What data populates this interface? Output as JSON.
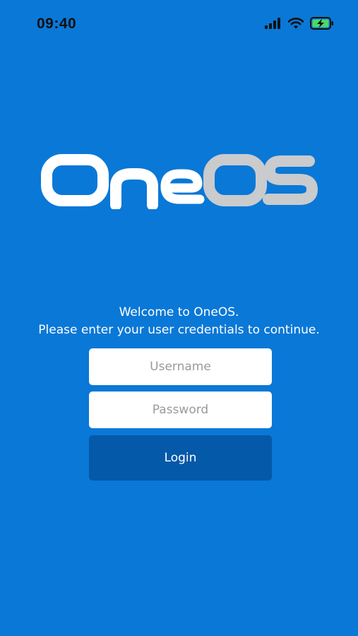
{
  "status_bar": {
    "time": "09:40",
    "signal_icon": "cellular-signal-icon",
    "wifi_icon": "wifi-icon",
    "battery_icon": "battery-charging-icon"
  },
  "logo": {
    "part1": "One",
    "part2": "OS",
    "colors": {
      "part1": "#FFFFFF",
      "part2": "#C9CBCD"
    }
  },
  "welcome": {
    "line1": "Welcome to OneOS.",
    "line2": "Please enter your user credentials to continue."
  },
  "form": {
    "username": {
      "placeholder": "Username",
      "value": ""
    },
    "password": {
      "placeholder": "Password",
      "value": ""
    },
    "login_label": "Login"
  },
  "colors": {
    "background": "#0A78D7",
    "login_button": "#0459A8",
    "battery_fill": "#4CD964"
  }
}
